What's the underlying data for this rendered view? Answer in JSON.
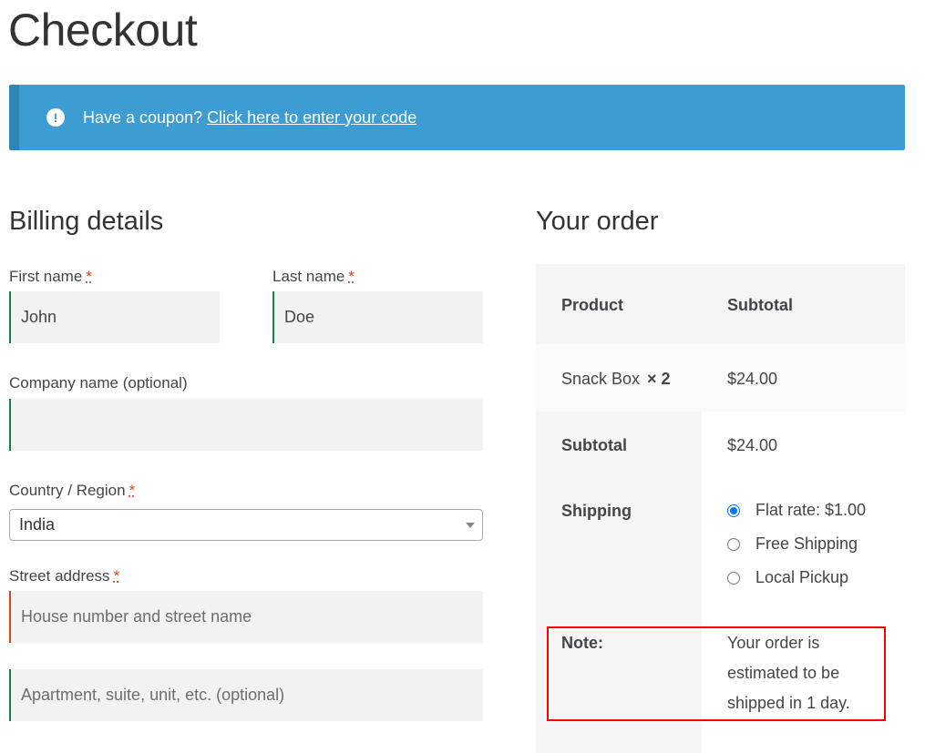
{
  "page": {
    "title": "Checkout"
  },
  "notice": {
    "text": "Have a coupon?",
    "link": "Click here to enter your code",
    "icon": "exclamation-icon"
  },
  "billing": {
    "title": "Billing details",
    "first_name": {
      "label": "First name",
      "required": "*",
      "value": "John"
    },
    "last_name": {
      "label": "Last name",
      "required": "*",
      "value": "Doe"
    },
    "company": {
      "label": "Company name (optional)",
      "value": ""
    },
    "country": {
      "label": "Country / Region",
      "required": "*",
      "value": "India"
    },
    "street": {
      "label": "Street address",
      "required": "*",
      "placeholder1": "House number and street name",
      "placeholder2": "Apartment, suite, unit, etc. (optional)"
    }
  },
  "order": {
    "title": "Your order",
    "headers": {
      "product": "Product",
      "subtotal": "Subtotal"
    },
    "item": {
      "name": "Snack Box",
      "qty": "× 2",
      "price": "$24.00"
    },
    "subtotal": {
      "label": "Subtotal",
      "value": "$24.00"
    },
    "shipping": {
      "label": "Shipping",
      "options": [
        {
          "label": "Flat rate: $1.00",
          "checked": true
        },
        {
          "label": "Free Shipping",
          "checked": false
        },
        {
          "label": "Local Pickup",
          "checked": false
        }
      ]
    },
    "note": {
      "label": "Note:",
      "text": "Your order is estimated to be shipped in 1 day."
    }
  },
  "colors": {
    "notice_bg": "#3d9cd2",
    "valid": "#0f834d",
    "invalid": "#e2401c",
    "highlight": "#ff0000"
  }
}
